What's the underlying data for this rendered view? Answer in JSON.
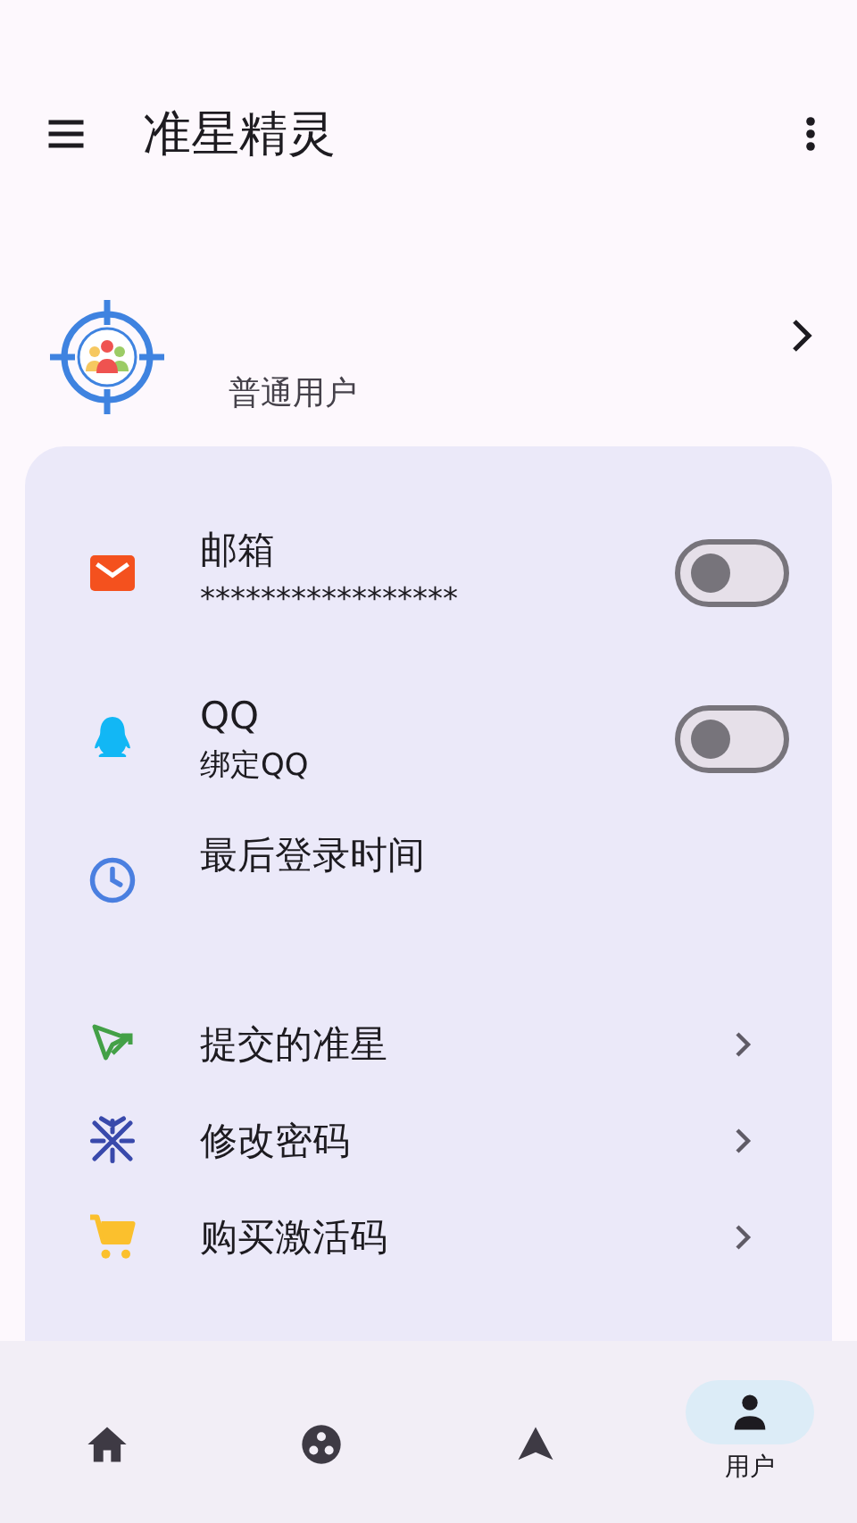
{
  "app_bar": {
    "title": "准星精灵"
  },
  "profile": {
    "role": "普通用户"
  },
  "items": [
    {
      "kind": "toggle",
      "title": "邮箱",
      "subtitle": "*****************",
      "on": false
    },
    {
      "kind": "toggle",
      "title": "QQ",
      "subtitle": "绑定QQ",
      "on": false
    },
    {
      "kind": "info",
      "title": "最后登录时间"
    },
    {
      "kind": "link",
      "title": "提交的准星"
    },
    {
      "kind": "link",
      "title": "修改密码"
    },
    {
      "kind": "link",
      "title": "购买激活码"
    }
  ],
  "nav": [
    {
      "selected": false
    },
    {
      "selected": false
    },
    {
      "selected": false
    },
    {
      "label": "用户",
      "selected": true
    }
  ]
}
